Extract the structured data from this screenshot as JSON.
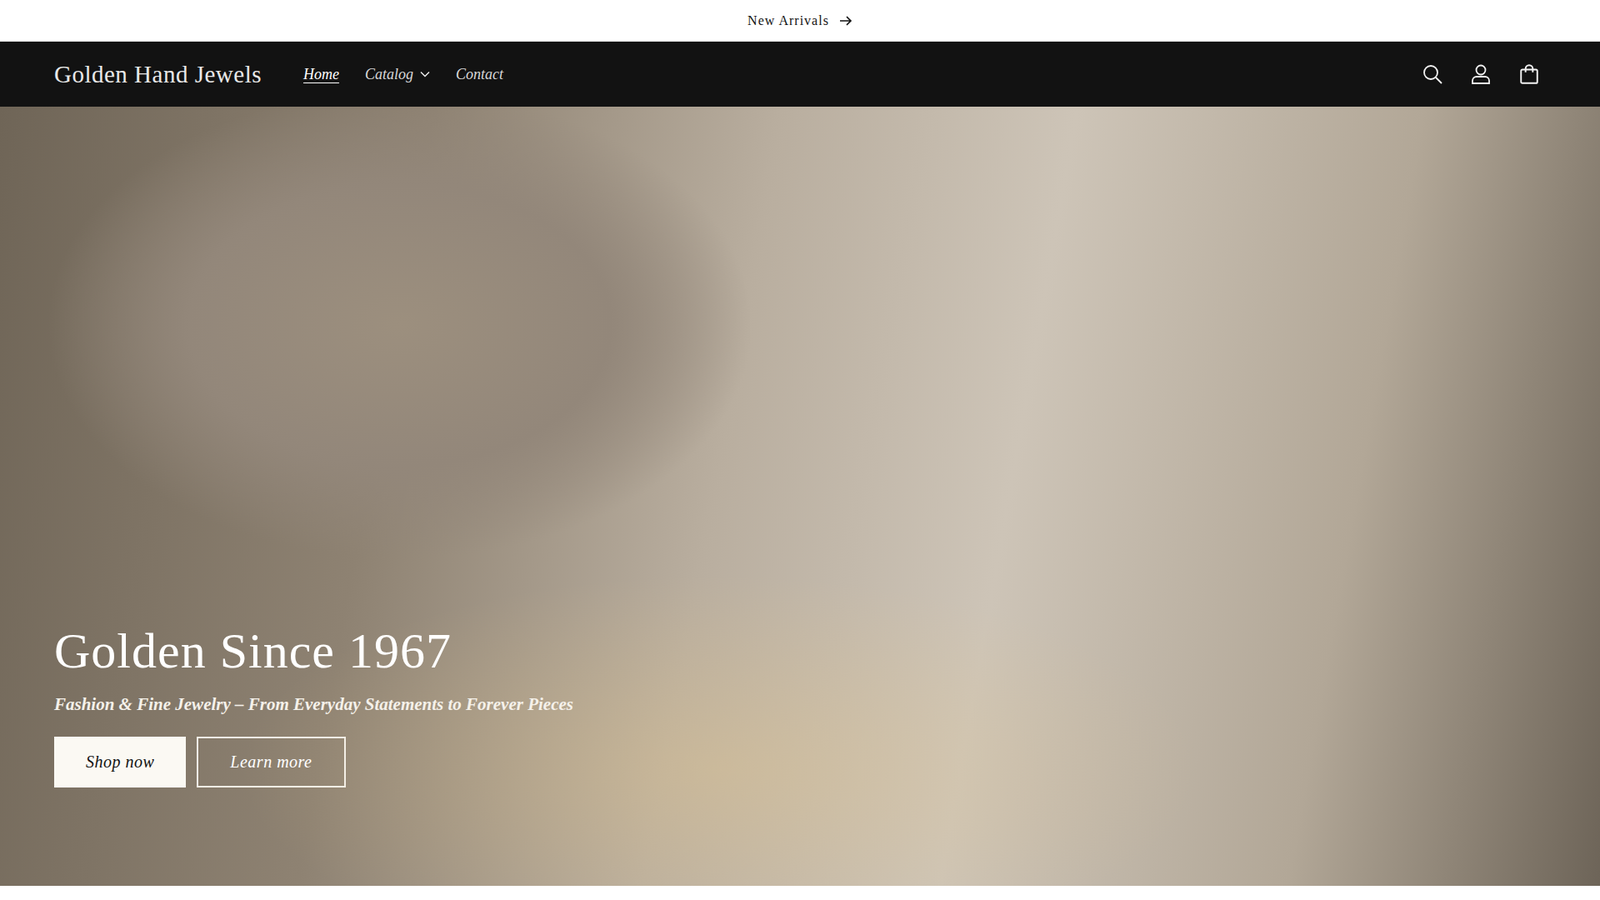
{
  "announcement": {
    "text": "New Arrivals"
  },
  "header": {
    "logo": "Golden Hand Jewels",
    "nav": [
      {
        "label": "Home",
        "selected": true,
        "has_dropdown": false
      },
      {
        "label": "Catalog",
        "selected": false,
        "has_dropdown": true
      },
      {
        "label": "Contact",
        "selected": false,
        "has_dropdown": false
      }
    ]
  },
  "hero": {
    "title": "Golden Since 1967",
    "subtitle": "Fashion & Fine Jewelry – From Everyday Statements to Forever Pieces",
    "buttons": [
      {
        "label": "Shop now",
        "kind": "primary"
      },
      {
        "label": "Learn more",
        "kind": "secondary"
      }
    ]
  }
}
